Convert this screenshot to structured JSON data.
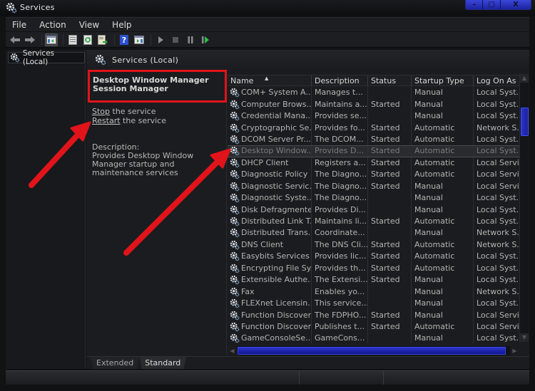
{
  "window": {
    "title": "Services",
    "controls": {
      "minimize": "–",
      "maximize": "□",
      "close": "X"
    }
  },
  "menu": [
    "File",
    "Action",
    "View",
    "Help"
  ],
  "toolbar": {
    "buttons": [
      "back-icon",
      "forward-icon",
      "show-hide-console-tree-icon",
      "properties-icon",
      "refresh-icon",
      "export-list-icon",
      "help-icon",
      "show-hide-action-pane-icon",
      "start-service-icon",
      "stop-service-icon",
      "pause-service-icon",
      "restart-service-icon"
    ]
  },
  "tree": {
    "root": "Services (Local)"
  },
  "pane": {
    "header": "Services (Local)",
    "selected_service": "Desktop Window Manager Session Manager",
    "actions": [
      {
        "link": "Stop",
        "rest": " the service"
      },
      {
        "link": "Restart",
        "rest": " the service"
      }
    ],
    "description_label": "Description:",
    "description_text": "Provides Desktop Window Manager startup and maintenance services"
  },
  "columns": [
    "Name",
    "Description",
    "Status",
    "Startup Type",
    "Log On As"
  ],
  "rows": [
    {
      "name": "COM+ System A...",
      "desc": "Manages t...",
      "status": "",
      "type": "Manual",
      "logon": "Local Syst..."
    },
    {
      "name": "Computer Brows...",
      "desc": "Maintains a...",
      "status": "Started",
      "type": "Manual",
      "logon": "Local Syst..."
    },
    {
      "name": "Credential Mana...",
      "desc": "Provides se...",
      "status": "",
      "type": "Manual",
      "logon": "Local Syst..."
    },
    {
      "name": "Cryptographic Se...",
      "desc": "Provides fo...",
      "status": "Started",
      "type": "Automatic",
      "logon": "Network S..."
    },
    {
      "name": "DCOM Server Pr...",
      "desc": "The DCOM...",
      "status": "Started",
      "type": "Automatic",
      "logon": "Local Syst..."
    },
    {
      "name": "Desktop Window...",
      "desc": "Provides D...",
      "status": "Started",
      "type": "Automatic",
      "logon": "Local Syst...",
      "selected": true
    },
    {
      "name": "DHCP Client",
      "desc": "Registers a...",
      "status": "Started",
      "type": "Automatic",
      "logon": "Local Servi..."
    },
    {
      "name": "Diagnostic Policy ...",
      "desc": "The Diagno...",
      "status": "Started",
      "type": "Automatic",
      "logon": "Local Servi..."
    },
    {
      "name": "Diagnostic Servic...",
      "desc": "The Diagno...",
      "status": "Started",
      "type": "Manual",
      "logon": "Local Servi..."
    },
    {
      "name": "Diagnostic Syste...",
      "desc": "The Diagno...",
      "status": "",
      "type": "Manual",
      "logon": "Local Syst..."
    },
    {
      "name": "Disk Defragmenter",
      "desc": "Provides Di...",
      "status": "",
      "type": "Manual",
      "logon": "Local Syst..."
    },
    {
      "name": "Distributed Link T...",
      "desc": "Maintains li...",
      "status": "Started",
      "type": "Automatic",
      "logon": "Local Syst..."
    },
    {
      "name": "Distributed Trans...",
      "desc": "Coordinate...",
      "status": "",
      "type": "Manual",
      "logon": "Network S..."
    },
    {
      "name": "DNS Client",
      "desc": "The DNS Cli...",
      "status": "Started",
      "type": "Automatic",
      "logon": "Network S..."
    },
    {
      "name": "Easybits Services ...",
      "desc": "Provides lic...",
      "status": "Started",
      "type": "Automatic",
      "logon": "Local Syst..."
    },
    {
      "name": "Encrypting File Sy...",
      "desc": "Provides th...",
      "status": "Started",
      "type": "Automatic",
      "logon": "Local Syst..."
    },
    {
      "name": "Extensible Authe...",
      "desc": "The Extensi...",
      "status": "Started",
      "type": "Manual",
      "logon": "Local Syst..."
    },
    {
      "name": "Fax",
      "desc": "Enables yo...",
      "status": "",
      "type": "Manual",
      "logon": "Network S..."
    },
    {
      "name": "FLEXnet Licensin...",
      "desc": "This service...",
      "status": "",
      "type": "Manual",
      "logon": "Local Syst..."
    },
    {
      "name": "Function Discover...",
      "desc": "The FDPHO...",
      "status": "Started",
      "type": "Manual",
      "logon": "Local Servi..."
    },
    {
      "name": "Function Discover...",
      "desc": "Publishes t...",
      "status": "Started",
      "type": "Automatic",
      "logon": "Local Servi..."
    },
    {
      "name": "GameConsoleSe...",
      "desc": "GameCons...",
      "status": "",
      "type": "Manual",
      "logon": "Local Syst..."
    }
  ],
  "tabs": [
    "Extended",
    "Standard"
  ],
  "active_tab": "Standard",
  "colors": {
    "annotation_red": "#e0141a",
    "scrollbar_blue": "#2a33c8",
    "window_controls_blue": "#3a46d8"
  }
}
